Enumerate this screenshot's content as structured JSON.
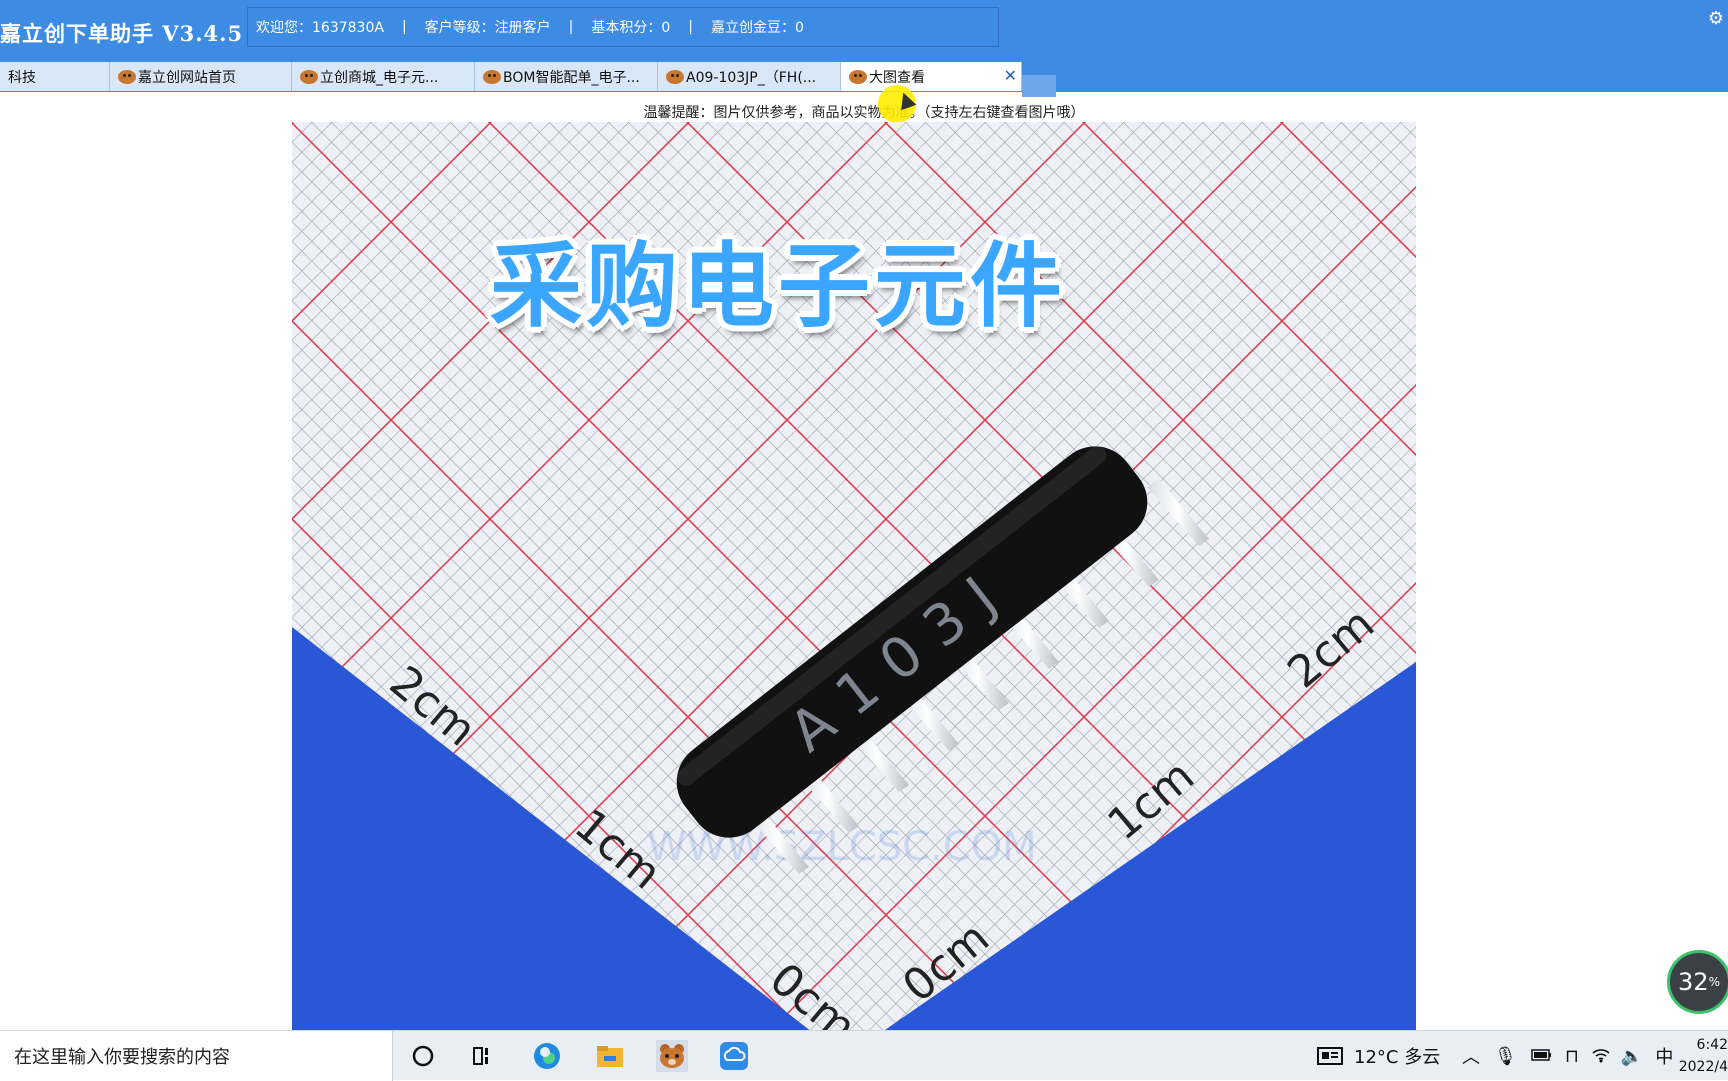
{
  "header": {
    "app_title": "嘉立创下单助手 V3.4.5",
    "welcome": "欢迎您：1637830A",
    "level": "客户等级：注册客户",
    "points": "基本积分：0",
    "beans": "嘉立创金豆：0",
    "settings_icon": "gear-icon"
  },
  "tabs": [
    {
      "label": "科技"
    },
    {
      "label": "嘉立创网站首页"
    },
    {
      "label": "立创商城_电子元..."
    },
    {
      "label": "BOM智能配单_电子..."
    },
    {
      "label": "A09-103JP_（FH(..."
    },
    {
      "label": "大图查看",
      "active": true
    }
  ],
  "notice": "温馨提醒：图片仅供参考，商品以实物为准。（支持左右键查看图片哦）",
  "image": {
    "overlay_title": "采购电子元件",
    "component_marking": "A103J",
    "scale_left_2": "2cm",
    "scale_left_1": "1cm",
    "scale_left_0": "0cm",
    "scale_right_2": "2cm",
    "scale_right_1": "1cm",
    "scale_right_0": "0cm",
    "watermark": "WWW.SZLCSC.COM",
    "colors": {
      "grid_red": "#e03a4a",
      "grid_gray": "#9aa3ad",
      "ruler_blue": "#2a57d6",
      "body_black": "#111111"
    }
  },
  "progress_badge": {
    "value": "32",
    "unit": "%"
  },
  "taskbar": {
    "search_placeholder": "在这里输入你要搜索的内容",
    "weather": "12°C 多云",
    "ime": "中",
    "time": "6:42",
    "date": "2022/4"
  }
}
